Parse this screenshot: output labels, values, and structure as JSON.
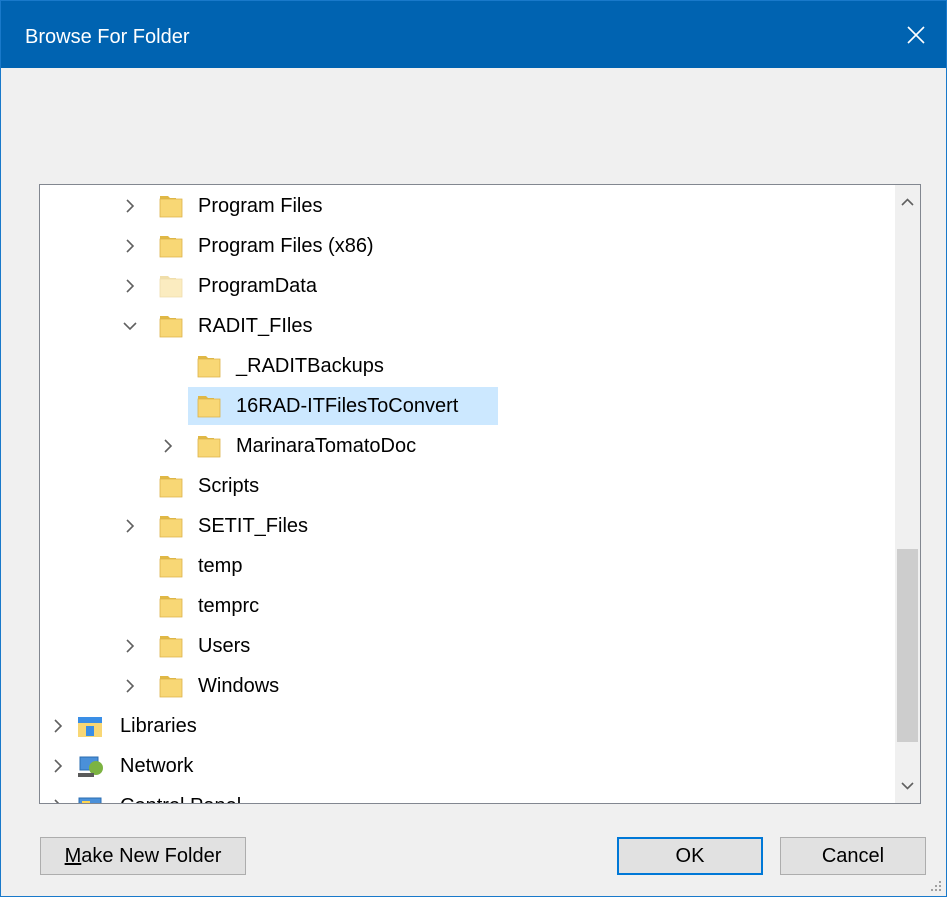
{
  "window": {
    "title": "Browse For Folder",
    "close_icon": "close-icon"
  },
  "tree": {
    "selected_index": 5,
    "items": [
      {
        "label": "Program Files",
        "indent": 1,
        "expander": "collapsed",
        "icon": "folder-icon"
      },
      {
        "label": "Program Files (x86)",
        "indent": 1,
        "expander": "collapsed",
        "icon": "folder-icon"
      },
      {
        "label": "ProgramData",
        "indent": 1,
        "expander": "collapsed",
        "icon": "folder-hidden-icon"
      },
      {
        "label": "RADIT_FIles",
        "indent": 1,
        "expander": "expanded",
        "icon": "folder-icon"
      },
      {
        "label": "_RADITBackups",
        "indent": 2,
        "expander": "none",
        "icon": "folder-icon"
      },
      {
        "label": "16RAD-ITFilesToConvert",
        "indent": 2,
        "expander": "none",
        "icon": "folder-icon"
      },
      {
        "label": "MarinaraTomatoDoc",
        "indent": 2,
        "expander": "collapsed",
        "icon": "folder-icon"
      },
      {
        "label": "Scripts",
        "indent": 1,
        "expander": "none",
        "icon": "folder-icon"
      },
      {
        "label": "SETIT_Files",
        "indent": 1,
        "expander": "collapsed",
        "icon": "folder-icon"
      },
      {
        "label": "temp",
        "indent": 1,
        "expander": "none",
        "icon": "folder-icon"
      },
      {
        "label": "temprc",
        "indent": 1,
        "expander": "none",
        "icon": "folder-icon"
      },
      {
        "label": "Users",
        "indent": 1,
        "expander": "collapsed",
        "icon": "folder-icon"
      },
      {
        "label": "Windows",
        "indent": 1,
        "expander": "collapsed",
        "icon": "folder-icon"
      },
      {
        "label": "Libraries",
        "indent": 0,
        "expander": "collapsed",
        "icon": "libraries-icon"
      },
      {
        "label": "Network",
        "indent": 0,
        "expander": "collapsed",
        "icon": "network-icon"
      },
      {
        "label": "Control Panel",
        "indent": 0,
        "expander": "collapsed",
        "icon": "control-panel-icon"
      }
    ]
  },
  "scrollbar": {
    "up_icon": "chevron-up-icon",
    "down_icon": "chevron-down-icon",
    "thumb_start_fraction": 0.6,
    "thumb_end_fraction": 0.95
  },
  "buttons": {
    "make_new_folder": {
      "mnemonic": "M",
      "rest": "ake New Folder"
    },
    "ok": "OK",
    "cancel": "Cancel"
  },
  "colors": {
    "titlebar": "#0063b1",
    "selection": "#cce8ff",
    "default_button_border": "#0078d7",
    "folder": "#f8d775"
  }
}
